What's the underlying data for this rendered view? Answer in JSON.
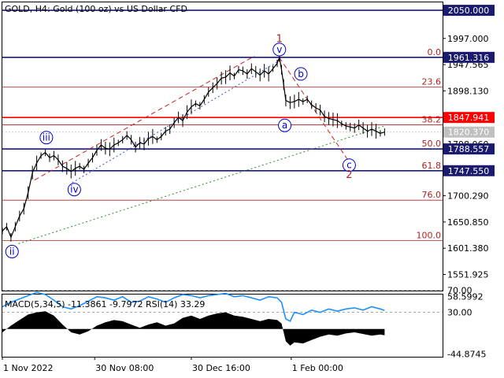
{
  "header": {
    "title": "GOLD, H4:  Gold (100 oz) vs US Dollar CFD"
  },
  "colors": {
    "price_line": "#000000",
    "fib_line": "#b22222",
    "level_line": "#1a1a6e",
    "current_line": "#ff0000",
    "label_blue": "#0000cc",
    "wave_red": "#b22222",
    "trend_dashed_red": "#cc2222",
    "trend_dotted_blue": "#3355cc",
    "trend_dotted_green": "#2e8b2e",
    "macd_hist": "#000000",
    "rsi_line": "#1e90ff"
  },
  "chart_data": [
    {
      "type": "line",
      "name": "price-panel",
      "ylim": [
        1520,
        2065
      ],
      "x_ticks": [
        {
          "label": "1 Nov 2022",
          "x": 0
        },
        {
          "label": "30 Nov 08:00",
          "x": 172
        },
        {
          "label": "30 Dec 16:00",
          "x": 352
        },
        {
          "label": "1 Feb 00:00",
          "x": 538
        }
      ],
      "xlim": [
        0,
        820
      ],
      "y_ticks": [
        1997.0,
        1947.565,
        1898.13,
        1798.06,
        1700.29,
        1650.85,
        1601.38,
        1551.925
      ],
      "y_tick_labels": [
        "1997.000",
        "1947.565",
        "1898.130",
        "1798.060",
        "1700.290",
        "1650.850",
        "1601.380",
        "1551.925"
      ],
      "price": [
        [
          0,
          1634
        ],
        [
          8,
          1642
        ],
        [
          16,
          1622
        ],
        [
          24,
          1642
        ],
        [
          32,
          1662
        ],
        [
          40,
          1676
        ],
        [
          48,
          1706
        ],
        [
          56,
          1744
        ],
        [
          64,
          1762
        ],
        [
          72,
          1776
        ],
        [
          80,
          1782
        ],
        [
          88,
          1772
        ],
        [
          96,
          1776
        ],
        [
          104,
          1768
        ],
        [
          112,
          1756
        ],
        [
          120,
          1752
        ],
        [
          128,
          1746
        ],
        [
          136,
          1752
        ],
        [
          144,
          1756
        ],
        [
          152,
          1750
        ],
        [
          160,
          1762
        ],
        [
          168,
          1772
        ],
        [
          176,
          1786
        ],
        [
          184,
          1796
        ],
        [
          192,
          1790
        ],
        [
          200,
          1788
        ],
        [
          208,
          1796
        ],
        [
          216,
          1800
        ],
        [
          224,
          1806
        ],
        [
          232,
          1814
        ],
        [
          240,
          1806
        ],
        [
          248,
          1792
        ],
        [
          256,
          1800
        ],
        [
          264,
          1798
        ],
        [
          272,
          1808
        ],
        [
          280,
          1812
        ],
        [
          288,
          1806
        ],
        [
          296,
          1812
        ],
        [
          304,
          1822
        ],
        [
          312,
          1826
        ],
        [
          320,
          1838
        ],
        [
          328,
          1848
        ],
        [
          336,
          1842
        ],
        [
          344,
          1858
        ],
        [
          352,
          1868
        ],
        [
          360,
          1874
        ],
        [
          368,
          1870
        ],
        [
          376,
          1882
        ],
        [
          384,
          1896
        ],
        [
          392,
          1904
        ],
        [
          400,
          1912
        ],
        [
          408,
          1922
        ],
        [
          416,
          1924
        ],
        [
          424,
          1932
        ],
        [
          432,
          1926
        ],
        [
          440,
          1938
        ],
        [
          448,
          1936
        ],
        [
          456,
          1930
        ],
        [
          464,
          1940
        ],
        [
          472,
          1934
        ],
        [
          480,
          1928
        ],
        [
          488,
          1936
        ],
        [
          496,
          1930
        ],
        [
          504,
          1940
        ],
        [
          512,
          1950
        ],
        [
          516,
          1961.3
        ],
        [
          520,
          1938
        ],
        [
          524,
          1910
        ],
        [
          528,
          1880
        ],
        [
          536,
          1876
        ],
        [
          544,
          1878
        ],
        [
          552,
          1882
        ],
        [
          560,
          1878
        ],
        [
          568,
          1882
        ],
        [
          576,
          1872
        ],
        [
          584,
          1866
        ],
        [
          592,
          1862
        ],
        [
          600,
          1850
        ],
        [
          608,
          1846
        ],
        [
          616,
          1844
        ],
        [
          624,
          1842
        ],
        [
          632,
          1836
        ],
        [
          640,
          1832
        ],
        [
          648,
          1830
        ],
        [
          656,
          1828
        ],
        [
          664,
          1834
        ],
        [
          672,
          1828
        ],
        [
          680,
          1822
        ],
        [
          688,
          1826
        ],
        [
          696,
          1822
        ],
        [
          704,
          1818
        ],
        [
          712,
          1820.37
        ]
      ],
      "levels": [
        {
          "label": "2050.000",
          "value": 2050.0,
          "fib": "",
          "style": "level"
        },
        {
          "label": "1961.316",
          "value": 1961.316,
          "fib": "0.0",
          "style": "level"
        },
        {
          "label": "",
          "value": 1905.6,
          "fib": "23.6",
          "style": "fib"
        },
        {
          "label": "1847.941",
          "value": 1847.941,
          "fib": "",
          "style": "current"
        },
        {
          "label": "",
          "value": 1834.0,
          "fib": "38.2",
          "style": "fib"
        },
        {
          "label": "1820.370",
          "value": 1820.37,
          "fib": "",
          "style": "price"
        },
        {
          "label": "1788.557",
          "value": 1788.557,
          "fib": "50.0",
          "style": "level"
        },
        {
          "label": "1747.550",
          "value": 1747.55,
          "fib": "61.8",
          "style": "level"
        },
        {
          "label": "",
          "value": 1692.0,
          "fib": "76.0",
          "style": "fib"
        },
        {
          "label": "",
          "value": 1616.0,
          "fib": "100.0",
          "style": "fib"
        }
      ],
      "wave_labels": [
        {
          "text": "ii",
          "x": 18,
          "y": 1595,
          "circled": true,
          "color": "blue"
        },
        {
          "text": "iii",
          "x": 82,
          "y": 1810,
          "circled": true,
          "color": "blue"
        },
        {
          "text": "iv",
          "x": 134,
          "y": 1712,
          "circled": true,
          "color": "blue"
        },
        {
          "text": "v",
          "x": 516,
          "y": 1976,
          "circled": true,
          "color": "blue"
        },
        {
          "text": "1",
          "x": 516,
          "y": 1996,
          "circled": false,
          "color": "red"
        },
        {
          "text": "a",
          "x": 526,
          "y": 1833,
          "circled": true,
          "color": "blue"
        },
        {
          "text": "b",
          "x": 556,
          "y": 1930,
          "circled": true,
          "color": "blue"
        },
        {
          "text": "c",
          "x": 646,
          "y": 1758,
          "circled": true,
          "color": "blue"
        },
        {
          "text": "2",
          "x": 646,
          "y": 1740,
          "circled": false,
          "color": "red"
        }
      ],
      "trend_lines": [
        {
          "style": "dashed-red",
          "points": [
            [
              60,
              1730
            ],
            [
              470,
              1964
            ]
          ]
        },
        {
          "style": "dashed-red",
          "points": [
            [
              516,
              1961
            ],
            [
              646,
              1764
            ]
          ]
        },
        {
          "style": "dotted-blue",
          "points": [
            [
              130,
              1725
            ],
            [
              516,
              1955
            ]
          ]
        },
        {
          "style": "dotted-green",
          "points": [
            [
              30,
              1610
            ],
            [
              712,
              1832
            ]
          ]
        }
      ]
    },
    {
      "type": "area",
      "name": "indicator-panel",
      "title": "MACD(5,34,5) -11.3861 -9.7972 RSI(14) 33.29",
      "ylim": [
        -50,
        62
      ],
      "y_ticks": [
        58.5992,
        70.0,
        30.0,
        -44.8745
      ],
      "y_tick_labels": [
        "58.5992",
        "70.00",
        "30.00",
        "-44.8745"
      ],
      "levels": [
        70,
        30
      ],
      "macd_hist": [
        [
          0,
          -6
        ],
        [
          16,
          6
        ],
        [
          32,
          16
        ],
        [
          48,
          26
        ],
        [
          64,
          30
        ],
        [
          80,
          32
        ],
        [
          96,
          24
        ],
        [
          112,
          8
        ],
        [
          128,
          -6
        ],
        [
          144,
          -10
        ],
        [
          160,
          -4
        ],
        [
          176,
          6
        ],
        [
          192,
          12
        ],
        [
          208,
          16
        ],
        [
          224,
          14
        ],
        [
          240,
          8
        ],
        [
          256,
          2
        ],
        [
          272,
          8
        ],
        [
          288,
          12
        ],
        [
          304,
          6
        ],
        [
          320,
          10
        ],
        [
          336,
          20
        ],
        [
          352,
          24
        ],
        [
          368,
          18
        ],
        [
          384,
          24
        ],
        [
          400,
          28
        ],
        [
          416,
          30
        ],
        [
          432,
          24
        ],
        [
          448,
          22
        ],
        [
          464,
          18
        ],
        [
          480,
          14
        ],
        [
          496,
          18
        ],
        [
          512,
          16
        ],
        [
          520,
          10
        ],
        [
          528,
          -22
        ],
        [
          536,
          -30
        ],
        [
          544,
          -24
        ],
        [
          560,
          -26
        ],
        [
          576,
          -20
        ],
        [
          592,
          -14
        ],
        [
          608,
          -10
        ],
        [
          624,
          -12
        ],
        [
          640,
          -8
        ],
        [
          656,
          -6
        ],
        [
          672,
          -9
        ],
        [
          688,
          -12
        ],
        [
          704,
          -10
        ],
        [
          712,
          -11.4
        ]
      ],
      "rsi": [
        [
          0,
          40
        ],
        [
          16,
          48
        ],
        [
          32,
          54
        ],
        [
          48,
          60
        ],
        [
          64,
          66
        ],
        [
          80,
          62
        ],
        [
          96,
          52
        ],
        [
          112,
          40
        ],
        [
          128,
          36
        ],
        [
          144,
          42
        ],
        [
          160,
          50
        ],
        [
          176,
          58
        ],
        [
          192,
          56
        ],
        [
          208,
          52
        ],
        [
          224,
          58
        ],
        [
          240,
          48
        ],
        [
          256,
          50
        ],
        [
          272,
          58
        ],
        [
          288,
          54
        ],
        [
          304,
          48
        ],
        [
          320,
          56
        ],
        [
          336,
          62
        ],
        [
          352,
          60
        ],
        [
          368,
          56
        ],
        [
          384,
          60
        ],
        [
          400,
          62
        ],
        [
          416,
          64
        ],
        [
          432,
          58
        ],
        [
          448,
          60
        ],
        [
          464,
          56
        ],
        [
          480,
          52
        ],
        [
          496,
          58
        ],
        [
          512,
          56
        ],
        [
          520,
          48
        ],
        [
          528,
          18
        ],
        [
          536,
          14
        ],
        [
          544,
          30
        ],
        [
          560,
          26
        ],
        [
          576,
          34
        ],
        [
          592,
          30
        ],
        [
          608,
          36
        ],
        [
          624,
          32
        ],
        [
          640,
          36
        ],
        [
          656,
          38
        ],
        [
          672,
          34
        ],
        [
          688,
          40
        ],
        [
          704,
          36
        ],
        [
          712,
          33.29
        ]
      ]
    }
  ]
}
